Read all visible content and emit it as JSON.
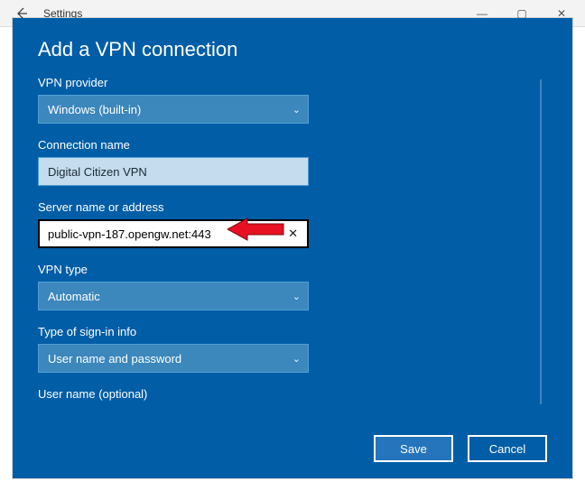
{
  "window": {
    "back_icon": "←",
    "title": "Settings",
    "controls": {
      "min": "—",
      "max": "▢",
      "close": "✕"
    }
  },
  "dialog": {
    "heading": "Add a VPN connection",
    "fields": {
      "provider": {
        "label": "VPN provider",
        "value": "Windows (built-in)"
      },
      "conn_name": {
        "label": "Connection name",
        "value": "Digital Citizen VPN"
      },
      "server": {
        "label": "Server name or address",
        "value": "public-vpn-187.opengw.net:443",
        "clear": "✕"
      },
      "vpn_type": {
        "label": "VPN type",
        "value": "Automatic"
      },
      "signin": {
        "label": "Type of sign-in info",
        "value": "User name and password"
      },
      "username": {
        "label": "User name (optional)"
      }
    },
    "buttons": {
      "save": "Save",
      "cancel": "Cancel"
    },
    "chevron": "⌄"
  }
}
